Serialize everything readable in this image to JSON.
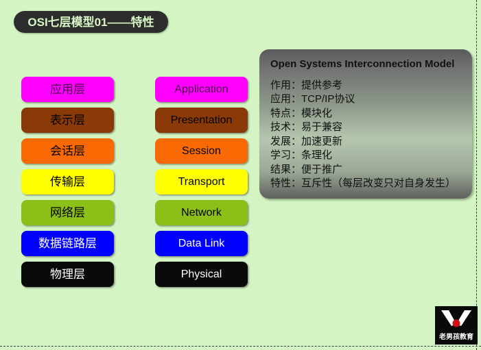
{
  "slide": {
    "background_color": "#d4f5c3",
    "title": "OSI七层模型01——特性",
    "title_bg_color": "#2d2d2d",
    "title_text_color": "#d8f7c5"
  },
  "layers_cn": [
    {
      "label": "应用层",
      "bg": "#ff00ff",
      "fg": "#4b0a4b"
    },
    {
      "label": "表示层",
      "bg": "#8a3a06",
      "fg": "#000000"
    },
    {
      "label": "会话层",
      "bg": "#f96a05",
      "fg": "#000000"
    },
    {
      "label": "传输层",
      "bg": "#ffff00",
      "fg": "#000000"
    },
    {
      "label": "网络层",
      "bg": "#8cbf18",
      "fg": "#000000"
    },
    {
      "label": "数据链路层",
      "bg": "#0000ff",
      "fg": "#ffffff"
    },
    {
      "label": "物理层",
      "bg": "#0a0a0a",
      "fg": "#ffffff"
    }
  ],
  "layers_en": [
    {
      "label": "Application",
      "bg": "#ff00ff",
      "fg": "#4b0a4b"
    },
    {
      "label": "Presentation",
      "bg": "#8a3a06",
      "fg": "#000000"
    },
    {
      "label": "Session",
      "bg": "#f96a05",
      "fg": "#000000"
    },
    {
      "label": "Transport",
      "bg": "#ffff00",
      "fg": "#000000"
    },
    {
      "label": "Network",
      "bg": "#8cbf18",
      "fg": "#000000"
    },
    {
      "label": "Data Link",
      "bg": "#0000ff",
      "fg": "#ffffff"
    },
    {
      "label": "Physical",
      "bg": "#0a0a0a",
      "fg": "#ffffff"
    }
  ],
  "info_panel": {
    "title": "Open Systems Interconnection Model",
    "lines": [
      "作用：提供参考",
      "应用：TCP/IP协议",
      "特点：模块化",
      "技术：易于兼容",
      "发展：加速更新",
      "学习：条理化",
      "结果：便于推广",
      "特性：互斥性（每层改变只对自身发生）"
    ]
  },
  "logo": {
    "text": "老男孩教育",
    "mark_color": "#ffffff",
    "dot_color": "#cc1111",
    "bg_color": "#0a0a0a"
  }
}
